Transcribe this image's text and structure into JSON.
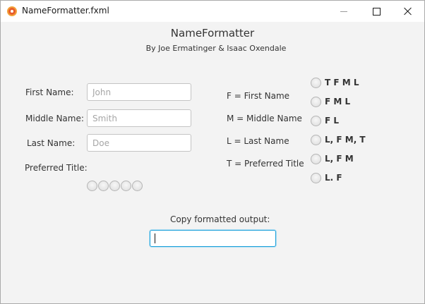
{
  "window": {
    "title": "NameFormatter.fxml",
    "icon": "app-icon",
    "controls": [
      "minimize-icon",
      "maximize-icon",
      "close-icon"
    ]
  },
  "header": {
    "title": "NameFormatter",
    "subtitle": "By Joe Ermatinger & Isaac Oxendale"
  },
  "form": {
    "first_name_label": "First Name:",
    "first_name_placeholder": "John",
    "middle_name_label": "Middle Name:",
    "middle_name_placeholder": "Smith",
    "last_name_label": "Last Name:",
    "last_name_placeholder": "Doe",
    "preferred_title_label": "Preferred Title:",
    "preferred_title_options": 5
  },
  "legend": {
    "f": "F = First Name",
    "m": "M = Middle Name",
    "l": "L = Last Name",
    "t": "T = Preferred Title"
  },
  "formats": [
    {
      "label": "T F M L",
      "selected": false
    },
    {
      "label": "F M L",
      "selected": false
    },
    {
      "label": "F L",
      "selected": false
    },
    {
      "label": "L, F M, T",
      "selected": false
    },
    {
      "label": "L, F M",
      "selected": false
    },
    {
      "label": "L. F",
      "selected": false
    }
  ],
  "output": {
    "label": "Copy formatted output:",
    "value": ""
  },
  "colors": {
    "focus_border": "#1a9fd9",
    "background": "#f3f3f3"
  }
}
